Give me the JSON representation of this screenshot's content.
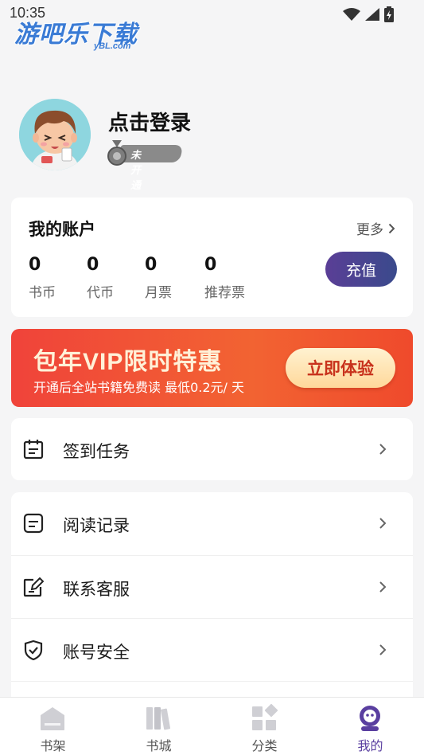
{
  "status_bar": {
    "time": "10:35"
  },
  "watermark": {
    "main": "游吧乐下载",
    "sub": "yBL.com"
  },
  "profile": {
    "login_text": "点击登录",
    "member_badge": "未开通"
  },
  "account": {
    "title": "我的账户",
    "more": "更多",
    "stats": [
      {
        "value": "0",
        "label": "书币"
      },
      {
        "value": "0",
        "label": "代币"
      },
      {
        "value": "0",
        "label": "月票"
      },
      {
        "value": "0",
        "label": "推荐票"
      }
    ],
    "recharge_button": "充值"
  },
  "vip_banner": {
    "title": "包年VIP限时特惠",
    "subtitle": "开通后全站书籍免费读 最低0.2元/ 天",
    "button": "立即体验"
  },
  "task": {
    "label": "签到任务"
  },
  "menu": [
    {
      "label": "阅读记录",
      "icon": "reading-record-icon"
    },
    {
      "label": "联系客服",
      "icon": "contact-service-icon"
    },
    {
      "label": "账号安全",
      "icon": "account-security-icon"
    }
  ],
  "tabs": [
    {
      "label": "书架",
      "icon": "bookshelf-icon"
    },
    {
      "label": "书城",
      "icon": "bookstore-icon"
    },
    {
      "label": "分类",
      "icon": "category-icon"
    },
    {
      "label": "我的",
      "icon": "mine-icon",
      "active": true
    }
  ],
  "colors": {
    "accent": "#5a3fa0",
    "vip_red": "#f0433a",
    "background": "#f5f5f6"
  }
}
